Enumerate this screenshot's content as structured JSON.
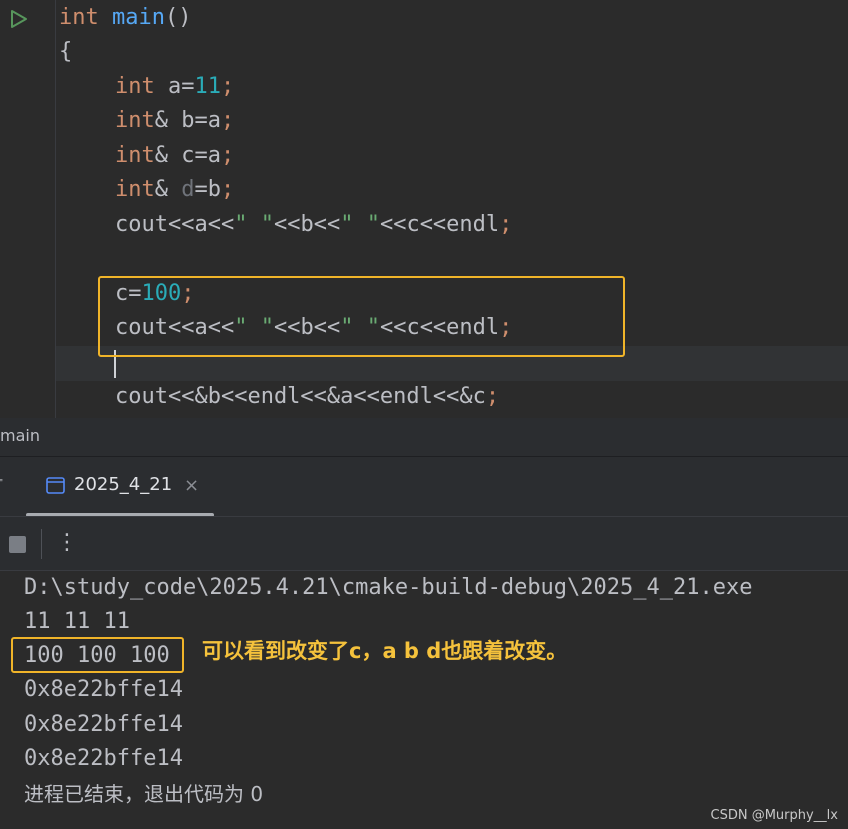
{
  "editor": {
    "gutter": {
      "run_icon": "run-triangle-icon"
    },
    "lines": {
      "l1": {
        "kw": "int",
        "fn": "main",
        "rest": "()"
      },
      "l2": {
        "text": "{"
      },
      "l3": {
        "kw": "int",
        "name": " a=",
        "num": "11",
        "semi": ";"
      },
      "l4": {
        "kw": "int",
        "amp": "&",
        "name": " b=a",
        "semi": ";"
      },
      "l5": {
        "kw": "int",
        "amp": "&",
        "name": " c=a",
        "semi": ";"
      },
      "l6": {
        "kw": "int",
        "amp": "&",
        "dim": " d",
        "name": "=b",
        "semi": ";"
      },
      "l7": {
        "p1": "cout<<a<<",
        "s1": "\" \"",
        "p2": "<<b<<",
        "s2": "\" \"",
        "p3": "<<c<<endl",
        "semi": ";"
      },
      "l8": {
        "name": "c=",
        "num": "100",
        "semi": ";"
      },
      "l9": {
        "p1": "cout<<a<<",
        "s1": "\" \"",
        "p2": "<<b<<",
        "s2": "\" \"",
        "p3": "<<c<<endl",
        "semi": ";"
      },
      "l10": {
        "text": "cout<<&b<<endl<<&a<<endl<<&c",
        "semi": ";"
      }
    }
  },
  "breadcrumb": {
    "label": "main"
  },
  "run_panel": {
    "tab": {
      "label": "2025_4_21",
      "close": "×",
      "icon": "console-window-icon"
    },
    "toolbar": {
      "stop_icon": "stop-icon",
      "more_icon": "more-vertical-icon",
      "more_glyph": "⋮"
    },
    "console": {
      "path": "D:\\study_code\\2025.4.21\\cmake-build-debug\\2025_4_21.exe",
      "line1": "11 11 11",
      "line2": "100 100 100",
      "line3": "0x8e22bffe14",
      "line4": "0x8e22bffe14",
      "line5": "0x8e22bffe14",
      "exit": "进程已结束，退出代码为 0"
    },
    "annotation": "可以看到改变了c，a b d也跟着改变。"
  },
  "watermark": "CSDN @Murphy__lx",
  "colors": {
    "highlight": "#f0b429",
    "annotation": "#f5c23c",
    "keyword": "#cf8e6d",
    "number": "#2aacb8",
    "string": "#6aab73"
  }
}
